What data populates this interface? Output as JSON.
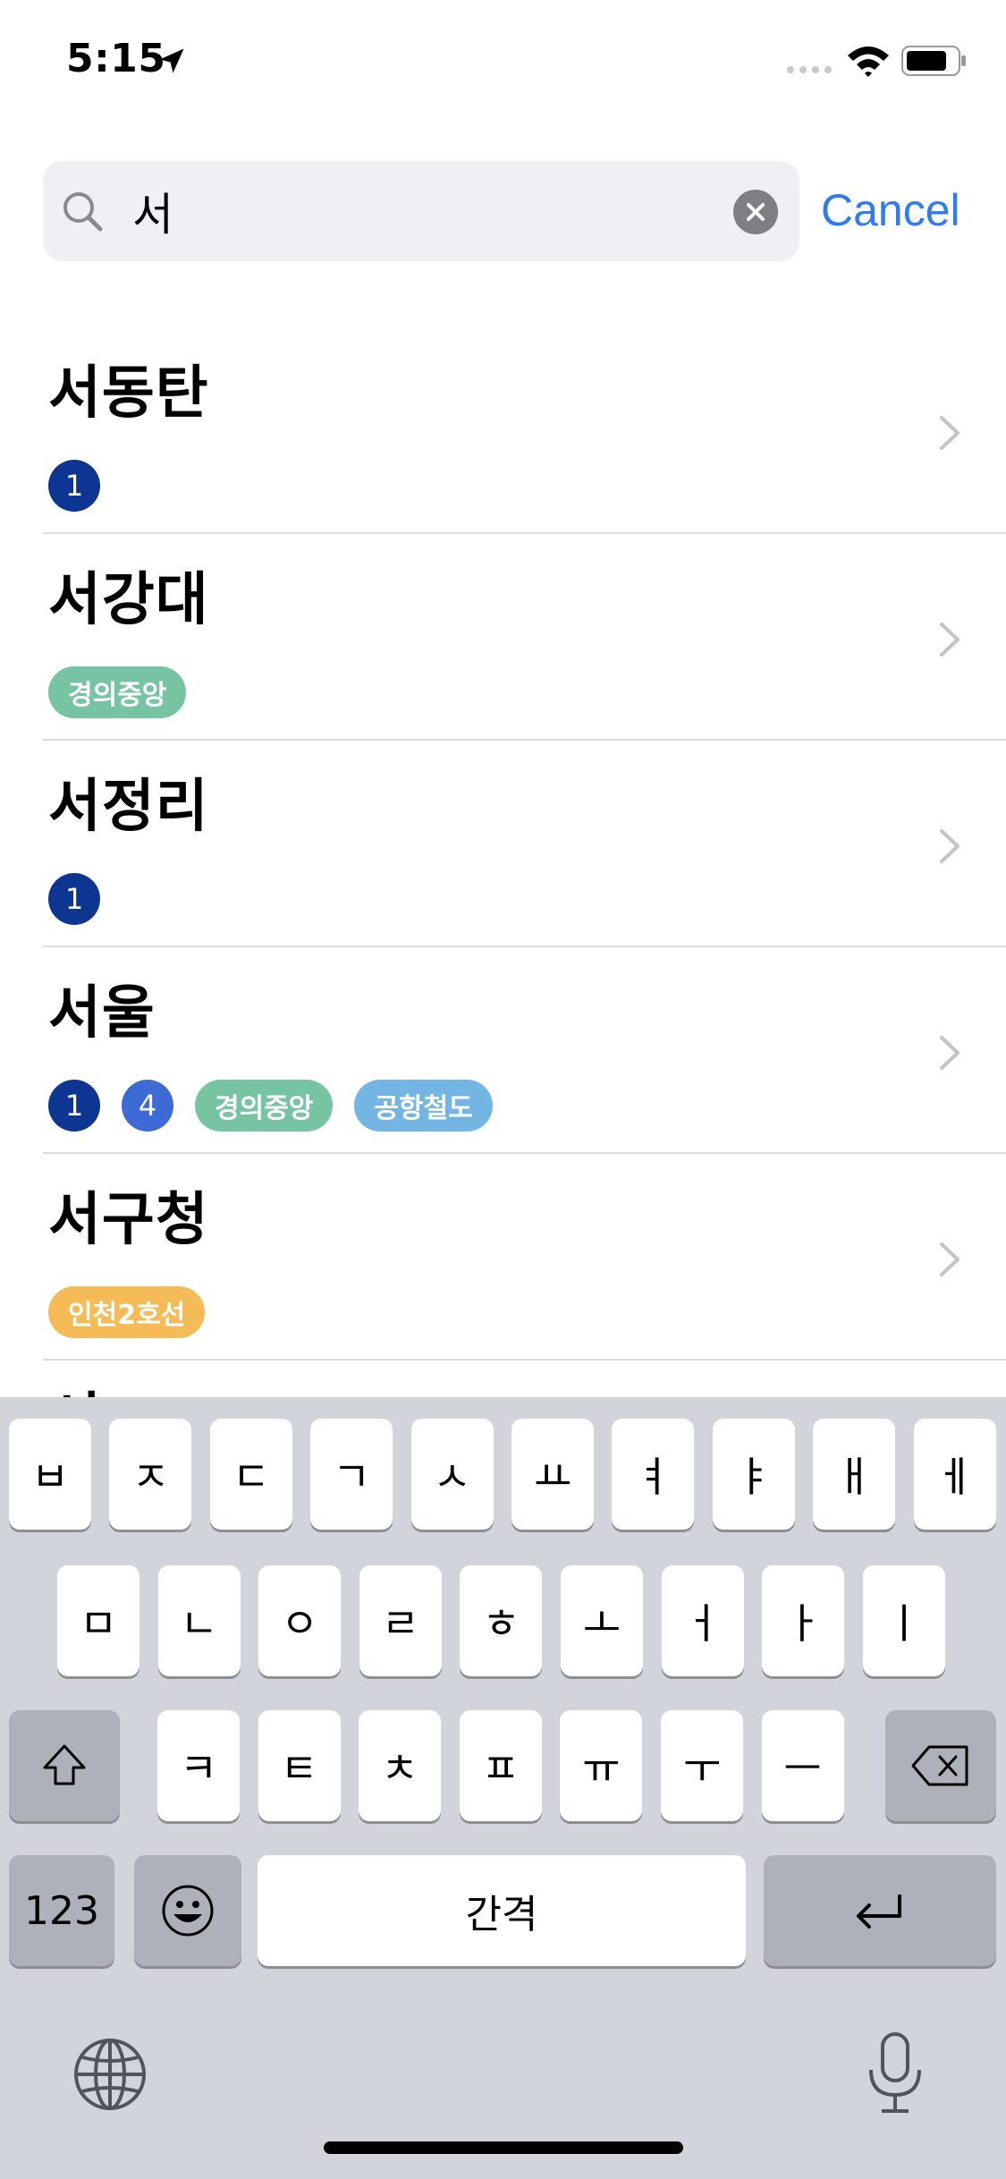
{
  "status_bar": {
    "time": "5:15"
  },
  "search": {
    "value": "서",
    "cancel_label": "Cancel"
  },
  "results": [
    {
      "name": "서동탄",
      "lines": [
        {
          "label": "1",
          "color": "#0d3692",
          "shape": "circle"
        }
      ]
    },
    {
      "name": "서강대",
      "lines": [
        {
          "label": "경의중앙",
          "color": "#77c4a3",
          "shape": "pill"
        }
      ]
    },
    {
      "name": "서정리",
      "lines": [
        {
          "label": "1",
          "color": "#0d3692",
          "shape": "circle"
        }
      ]
    },
    {
      "name": "서울",
      "lines": [
        {
          "label": "1",
          "color": "#0d3692",
          "shape": "circle"
        },
        {
          "label": "4",
          "color": "#3d6ad4",
          "shape": "circle"
        },
        {
          "label": "경의중앙",
          "color": "#77c4a3",
          "shape": "pill"
        },
        {
          "label": "공항철도",
          "color": "#73b6e4",
          "shape": "pill"
        }
      ]
    },
    {
      "name": "서구청",
      "lines": [
        {
          "label": "인천2호선",
          "color": "#f5bb56",
          "shape": "pill"
        }
      ]
    }
  ],
  "partial_row": "서",
  "keyboard": {
    "row1": [
      "ㅂ",
      "ㅈ",
      "ㄷ",
      "ㄱ",
      "ㅅ",
      "ㅛ",
      "ㅕ",
      "ㅑ",
      "ㅐ",
      "ㅔ"
    ],
    "row2": [
      "ㅁ",
      "ㄴ",
      "ㅇ",
      "ㄹ",
      "ㅎ",
      "ㅗ",
      "ㅓ",
      "ㅏ",
      "ㅣ"
    ],
    "row3": [
      "ㅋ",
      "ㅌ",
      "ㅊ",
      "ㅍ",
      "ㅠ",
      "ㅜ",
      "ㅡ"
    ],
    "numbers_label": "123",
    "space_label": "간격"
  },
  "colors": {
    "accent": "#2f7bf6"
  }
}
